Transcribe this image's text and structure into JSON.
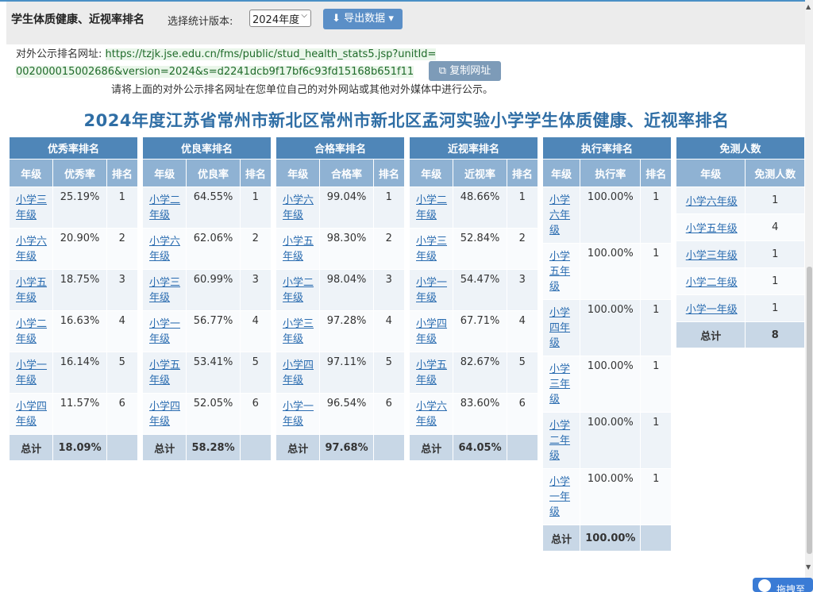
{
  "header": {
    "app_title": "学生体质健康、近视率排名",
    "version_label": "选择统计版本:",
    "version_selected": "2024年度",
    "export_label": "导出数据"
  },
  "public": {
    "label": "对外公示排名网址:",
    "url": "https://tzjk.jse.edu.cn/fms/public/stud_health_stats5.jsp?unitId=002000015002686&version=2024&s=d2241dcb9f17bf6c93fd15168b651f11",
    "copy_label": "复制网址",
    "hint": "请将上面的对外公示排名网址在您单位自己的对外网站或其他对外媒体中进行公示。"
  },
  "report_title": "2024年度江苏省常州市新北区常州市新北区孟河实验小学学生体质健康、近视率排名",
  "tables": {
    "excellent": {
      "caption": "优秀率排名",
      "col_grade": "年级",
      "col_rate": "优秀率",
      "col_rank": "排名",
      "rows": [
        {
          "grade": "小学三年级",
          "rate": "25.19%",
          "rank": "1"
        },
        {
          "grade": "小学六年级",
          "rate": "20.90%",
          "rank": "2"
        },
        {
          "grade": "小学五年级",
          "rate": "18.75%",
          "rank": "3"
        },
        {
          "grade": "小学二年级",
          "rate": "16.63%",
          "rank": "4"
        },
        {
          "grade": "小学一年级",
          "rate": "16.14%",
          "rank": "5"
        },
        {
          "grade": "小学四年级",
          "rate": "11.57%",
          "rank": "6"
        }
      ],
      "total_label": "总计",
      "total": "18.09%"
    },
    "good": {
      "caption": "优良率排名",
      "col_grade": "年级",
      "col_rate": "优良率",
      "col_rank": "排名",
      "rows": [
        {
          "grade": "小学二年级",
          "rate": "64.55%",
          "rank": "1"
        },
        {
          "grade": "小学六年级",
          "rate": "62.06%",
          "rank": "2"
        },
        {
          "grade": "小学三年级",
          "rate": "60.99%",
          "rank": "3"
        },
        {
          "grade": "小学一年级",
          "rate": "56.77%",
          "rank": "4"
        },
        {
          "grade": "小学五年级",
          "rate": "53.41%",
          "rank": "5"
        },
        {
          "grade": "小学四年级",
          "rate": "52.05%",
          "rank": "6"
        }
      ],
      "total_label": "总计",
      "total": "58.28%"
    },
    "pass": {
      "caption": "合格率排名",
      "col_grade": "年级",
      "col_rate": "合格率",
      "col_rank": "排名",
      "rows": [
        {
          "grade": "小学六年级",
          "rate": "99.04%",
          "rank": "1"
        },
        {
          "grade": "小学五年级",
          "rate": "98.30%",
          "rank": "2"
        },
        {
          "grade": "小学二年级",
          "rate": "98.04%",
          "rank": "3"
        },
        {
          "grade": "小学三年级",
          "rate": "97.28%",
          "rank": "4"
        },
        {
          "grade": "小学四年级",
          "rate": "97.11%",
          "rank": "5"
        },
        {
          "grade": "小学一年级",
          "rate": "96.54%",
          "rank": "6"
        }
      ],
      "total_label": "总计",
      "total": "97.68%"
    },
    "myopia": {
      "caption": "近视率排名",
      "col_grade": "年级",
      "col_rate": "近视率",
      "col_rank": "排名",
      "rows": [
        {
          "grade": "小学二年级",
          "rate": "48.66%",
          "rank": "1"
        },
        {
          "grade": "小学三年级",
          "rate": "52.84%",
          "rank": "2"
        },
        {
          "grade": "小学一年级",
          "rate": "54.47%",
          "rank": "3"
        },
        {
          "grade": "小学四年级",
          "rate": "67.71%",
          "rank": "4"
        },
        {
          "grade": "小学五年级",
          "rate": "82.67%",
          "rank": "5"
        },
        {
          "grade": "小学六年级",
          "rate": "83.60%",
          "rank": "6"
        }
      ],
      "total_label": "总计",
      "total": "64.05%"
    },
    "execution": {
      "caption": "执行率排名",
      "col_grade": "年级",
      "col_rate": "执行率",
      "col_rank": "排名",
      "rows": [
        {
          "grade": "小学六年级",
          "rate": "100.00%",
          "rank": "1"
        },
        {
          "grade": "小学五年级",
          "rate": "100.00%",
          "rank": "1"
        },
        {
          "grade": "小学四年级",
          "rate": "100.00%",
          "rank": "1"
        },
        {
          "grade": "小学三年级",
          "rate": "100.00%",
          "rank": "1"
        },
        {
          "grade": "小学二年级",
          "rate": "100.00%",
          "rank": "1"
        },
        {
          "grade": "小学一年级",
          "rate": "100.00%",
          "rank": "1"
        }
      ],
      "total_label": "总计",
      "total": "100.00%"
    },
    "exempt": {
      "caption": "免测人数",
      "col_grade": "年级",
      "col_count": "免测人数",
      "rows": [
        {
          "grade": "小学六年级",
          "count": "1"
        },
        {
          "grade": "小学五年级",
          "count": "4"
        },
        {
          "grade": "小学三年级",
          "count": "1"
        },
        {
          "grade": "小学二年级",
          "count": "1"
        },
        {
          "grade": "小学一年级",
          "count": "1"
        }
      ],
      "total_label": "总计",
      "total": "8"
    }
  },
  "bottom_button": "拖拽至"
}
